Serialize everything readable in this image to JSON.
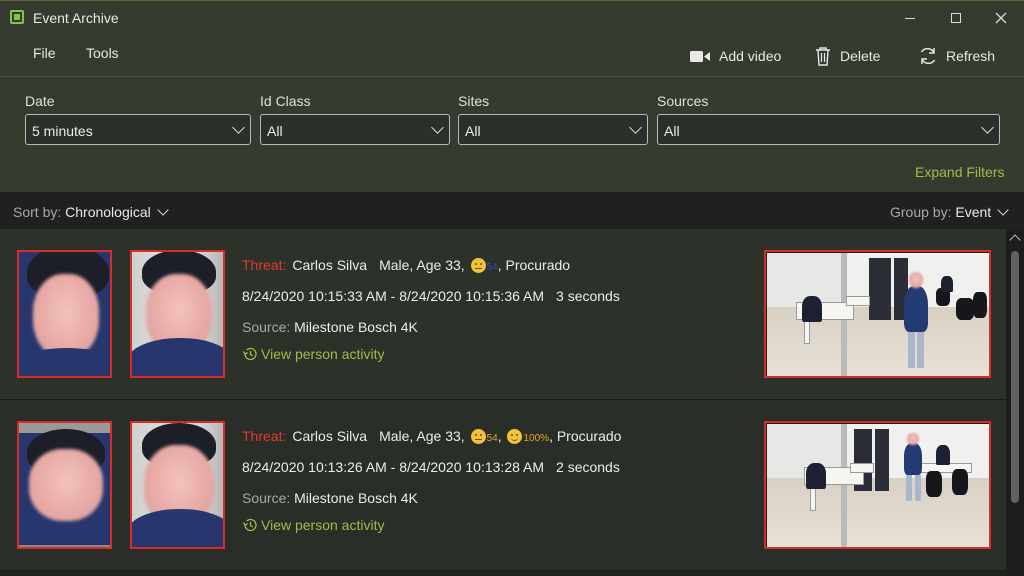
{
  "window": {
    "title": "Event Archive"
  },
  "menu": {
    "file": "File",
    "tools": "Tools"
  },
  "toolbar": {
    "add_video": "Add video",
    "delete": "Delete",
    "refresh": "Refresh"
  },
  "filters": {
    "date": {
      "label": "Date",
      "value": "5 minutes"
    },
    "id_class": {
      "label": "Id Class",
      "value": "All"
    },
    "sites": {
      "label": "Sites",
      "value": "All"
    },
    "sources": {
      "label": "Sources",
      "value": "All"
    },
    "expand": "Expand Filters"
  },
  "sort": {
    "label": "Sort by:",
    "value": "Chronological"
  },
  "group": {
    "label": "Group by:",
    "value": "Event"
  },
  "events": [
    {
      "threat_label": "Threat:",
      "name": "Carlos Silva",
      "demographics": "Male, Age 33,",
      "emotions": [
        {
          "icon": "neutral-emoji-icon",
          "score": "54"
        }
      ],
      "tag": ", Procurado",
      "time_range": "8/24/2020 10:15:33 AM - 8/24/2020 10:15:36 AM",
      "duration": "3 seconds",
      "source_label": "Source:",
      "source": "Milestone Bosch 4K",
      "action": "View person activity"
    },
    {
      "threat_label": "Threat:",
      "name": "Carlos Silva",
      "demographics": "Male, Age 33,",
      "emotions": [
        {
          "icon": "neutral-emoji-icon",
          "score": "54"
        },
        {
          "icon": "happy-emoji-icon",
          "score": "100%"
        }
      ],
      "tag": ", Procurado",
      "time_range": "8/24/2020 10:13:26 AM - 8/24/2020 10:13:28 AM",
      "duration": "2 seconds",
      "source_label": "Source:",
      "source": "Milestone Bosch 4K",
      "action": "View person activity"
    }
  ],
  "colors": {
    "accent": "#9bbf4a",
    "threat": "#e23b2c",
    "alert_border": "#d92b2b",
    "header_bg": "#353b2f"
  }
}
